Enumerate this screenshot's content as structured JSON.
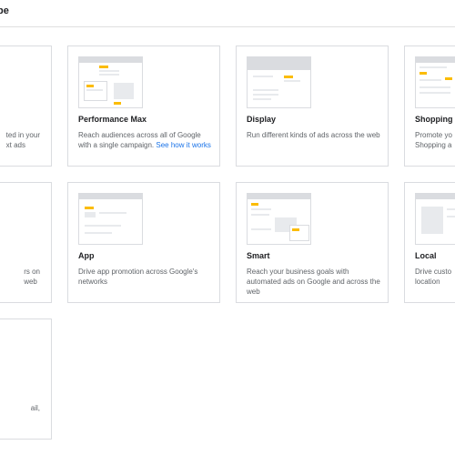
{
  "header": {
    "title": "pe"
  },
  "cards": {
    "search": {
      "desc_line1": "ted in your",
      "desc_line2": "xt ads"
    },
    "performance_max": {
      "title": "Performance Max",
      "desc": "Reach audiences across all of Google with a single campaign.",
      "link": "See how it works"
    },
    "display": {
      "title": "Display",
      "desc": "Run different kinds of ads across the web"
    },
    "shopping": {
      "title": "Shopping",
      "desc_line1": "Promote yo",
      "desc_line2": "Shopping a"
    },
    "video": {
      "desc_line1": "rs on",
      "desc_line2": "web"
    },
    "app": {
      "title": "App",
      "desc": "Drive app promotion across Google's networks"
    },
    "smart": {
      "title": "Smart",
      "desc": "Reach your business goals with automated ads on Google and across the web"
    },
    "local": {
      "title": "Local",
      "desc_line1": "Drive custo",
      "desc_line2": "location"
    },
    "discovery": {
      "desc_line1": "ail,"
    }
  }
}
